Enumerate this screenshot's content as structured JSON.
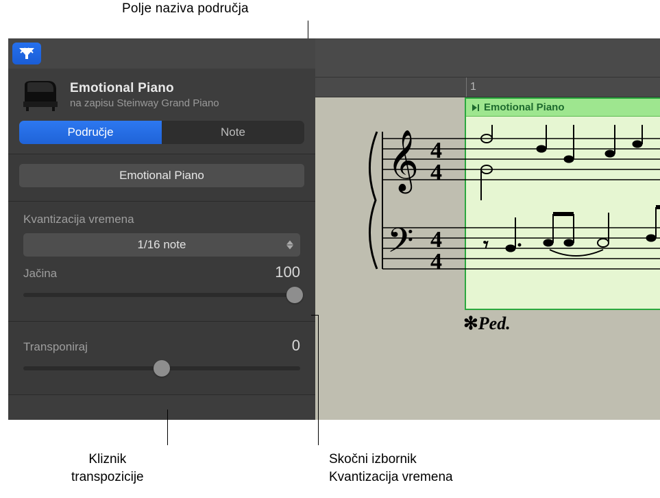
{
  "callouts": {
    "top": "Polje naziva područja",
    "bottom_left_l1": "Klizník",
    "bottom_left_l1b": "Klizník transpozicije",
    "bottom_left": "Klizník\ntranspozicije",
    "bl1": "Klizník",
    "bl2": "transpozicije",
    "br1": "Skočni izbornik",
    "br2": "Kvantizacija vremena"
  },
  "callout_fix": {
    "bl1": "Kliznik",
    "bl2": "transpozicije"
  },
  "header": {
    "title": "Emotional Piano",
    "subtitle": "na zapisu Steinway Grand Piano"
  },
  "tabs": {
    "region": "Područje",
    "notes": "Note"
  },
  "name_field": "Emotional Piano",
  "quantize": {
    "label": "Kvantizacija vremena",
    "value": "1/16 note"
  },
  "velocity": {
    "label": "Jačina",
    "value": "100"
  },
  "transpose": {
    "label": "Transponiraj",
    "value": "0"
  },
  "ruler": {
    "mark": "1"
  },
  "region": {
    "name": "Emotional Piano"
  },
  "ped": "✽𝆯𝆮",
  "ped_text": "Ped."
}
